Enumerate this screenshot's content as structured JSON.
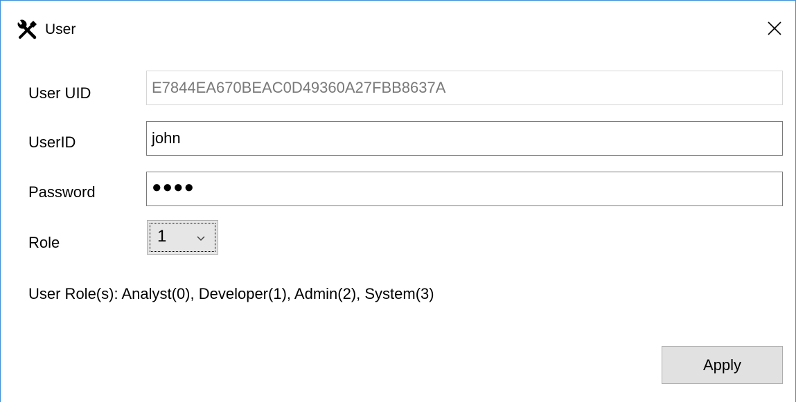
{
  "window": {
    "title": "User",
    "title_icon": "tools-icon",
    "close_icon": "close-icon"
  },
  "form": {
    "uid_label": "User UID",
    "uid_value": "E7844EA670BEAC0D49360A27FBB8637A",
    "userid_label": "UserID",
    "userid_value": "john",
    "password_label": "Password",
    "password_masked": "●●●●",
    "role_label": "Role",
    "role_value": "1",
    "roles_info": "User Role(s): Analyst(0), Developer(1), Admin(2), System(3)"
  },
  "actions": {
    "apply_label": "Apply"
  },
  "colors": {
    "window_border": "#3b8fd8",
    "button_bg": "#e1e1e1",
    "disabled_text": "#7a7a7a"
  }
}
